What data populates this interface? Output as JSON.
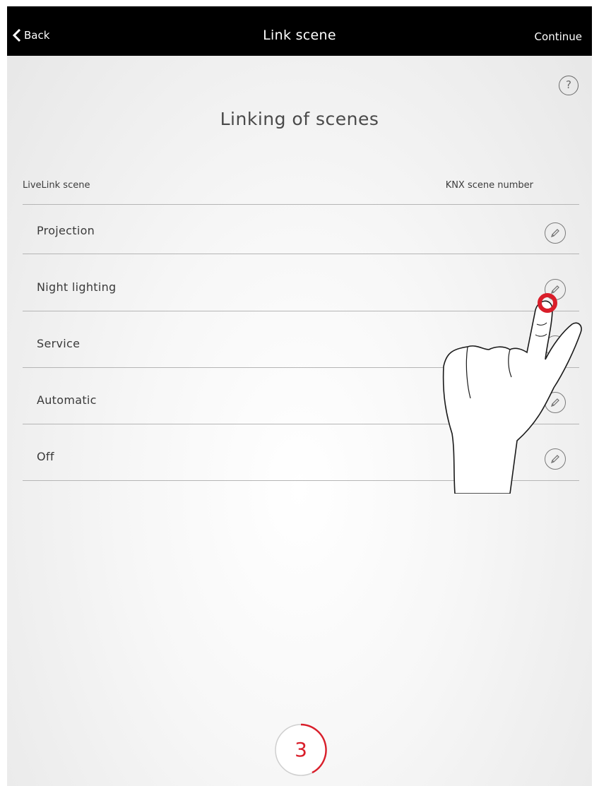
{
  "navbar": {
    "back_label": "Back",
    "title": "Link scene",
    "continue_label": "Continue",
    "background": "#000000"
  },
  "help": {
    "symbol": "?"
  },
  "page": {
    "title": "Linking of scenes"
  },
  "columns": {
    "left": "LiveLink scene",
    "right": "KNX scene number"
  },
  "scenes": [
    {
      "label": "Projection"
    },
    {
      "label": "Night lighting"
    },
    {
      "label": "Service"
    },
    {
      "label": "Automatic"
    },
    {
      "label": "Off"
    }
  ],
  "step": {
    "number": "3",
    "accent": "#d91e2a"
  },
  "icons": {
    "back": "chevron-left-icon",
    "help": "question-circle-icon",
    "edit": "pencil-circle-icon",
    "pointer": "hand-pointer-icon"
  }
}
